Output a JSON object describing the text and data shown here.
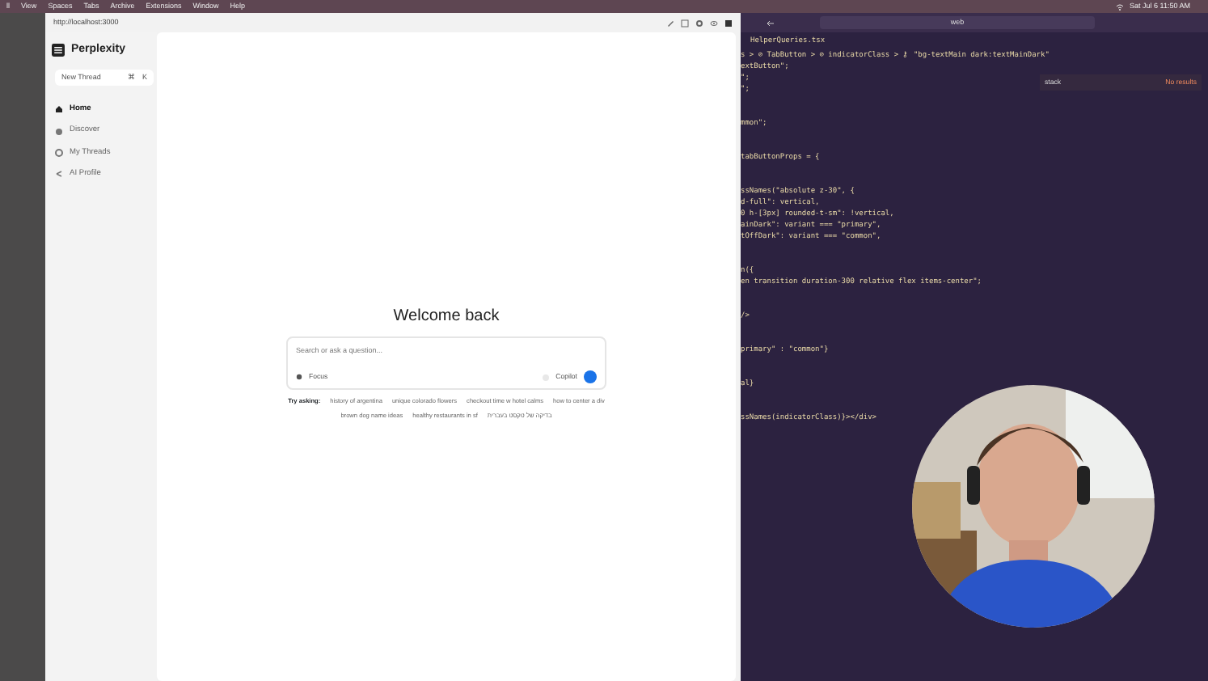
{
  "menu_bar": {
    "items": [
      "ll",
      "View",
      "Spaces",
      "Tabs",
      "Archive",
      "Extensions",
      "Window",
      "Help"
    ],
    "clock": "Sat Jul 6 11:50 AM"
  },
  "browser": {
    "url": "http://localhost:3000"
  },
  "sidebar": {
    "brand": "Perplexity",
    "new_thread": {
      "label": "New Thread",
      "shortcut_1": "⌘",
      "shortcut_2": "K"
    },
    "items": [
      {
        "label": "Home",
        "selected": true
      },
      {
        "label": "Discover",
        "selected": false
      },
      {
        "label": "My Threads",
        "selected": false
      },
      {
        "label": "AI Profile",
        "selected": false
      }
    ]
  },
  "main": {
    "title": "Welcome back",
    "search": {
      "placeholder": "Search or ask a question..."
    },
    "focus": "Focus",
    "copilot": "Copilot",
    "copilot_on": false,
    "try_label": "Try asking:",
    "suggestions": [
      "history of argentina",
      "unique colorado flowers",
      "checkout time w hotel calms",
      "how to center a div",
      "brown dog name ideas",
      "healthy restaurants in sf",
      "בדיקה של טקסט בעברית"
    ]
  },
  "editor": {
    "command_center": "web",
    "file_tab": "HelperQueries.tsx",
    "breadcrumb": "s > ⊘ TabButton > ⊘ indicatorClass > ⚷ \"bg-textMain dark:textMainDark\"",
    "find": {
      "value": "stack",
      "result": "No results"
    },
    "code_blocks": [
      [
        "extButton\";",
        "\";",
        "\";"
      ],
      [
        "mmon\";"
      ],
      [
        "tabButtonProps = {"
      ],
      [
        "ssNames(\"absolute z-30\", {",
        "d-full\": vertical,",
        "0 h-[3px] rounded-t-sm\": !vertical,",
        "ainDark\": variant === \"primary\",",
        "tOffDark\": variant === \"common\","
      ],
      [
        "n({",
        "en transition duration-300 relative flex items-center\";"
      ],
      [
        "/>"
      ],
      [
        "primary\" : \"common\"}"
      ],
      [
        "al}"
      ],
      [
        "ssNames(indicatorClass)}></div>"
      ]
    ]
  }
}
